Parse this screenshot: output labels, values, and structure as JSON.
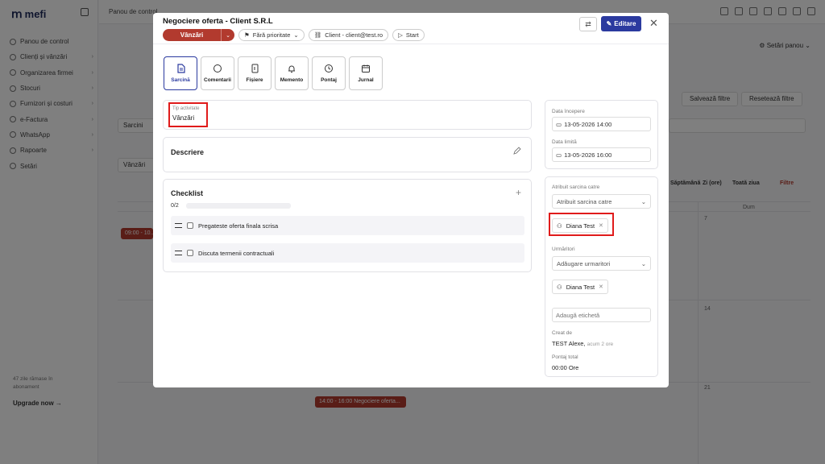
{
  "background": {
    "app_name": "mefi",
    "nav": [
      "Panou de control",
      "Clienți și vânzări",
      "Organizarea firmei",
      "Stocuri",
      "Furnizori și costuri",
      "e-Factura",
      "WhatsApp",
      "Rapoarte",
      "Setări"
    ],
    "trial_text": "47 zile rămase în abonament",
    "upgrade_label": "Upgrade now →",
    "breadcrumb": "Panou de control",
    "settings_label": "Setări panou",
    "save_filters": "Salvează filtre",
    "reset_filters": "Resetează filtre",
    "filter1_value": "Sarcini",
    "filter2_value": "Vânzări",
    "view_buttons": [
      "Săptămână",
      "Zi (ore)",
      "Toată ziua",
      "Filtre"
    ],
    "weekday": "Dum",
    "day_numbers": [
      "7",
      "14",
      "21"
    ],
    "event_left": "09:00 - 10...",
    "event_center": "14:00 - 16:00 Negociere oferta..."
  },
  "modal": {
    "title": "Negociere oferta - Client S.R.L",
    "status_label": "Vânzări",
    "priority_label": "Fără prioritate",
    "client_label": "Client - client@test.ro",
    "start_label": "Start",
    "edit_label": "Editare",
    "tabs": [
      {
        "label": "Sarcină",
        "icon": "document-icon"
      },
      {
        "label": "Comentarii",
        "icon": "comment-icon"
      },
      {
        "label": "Fișiere",
        "icon": "file-icon"
      },
      {
        "label": "Memento",
        "icon": "bell-icon"
      },
      {
        "label": "Pontaj",
        "icon": "clock-icon"
      },
      {
        "label": "Jurnal",
        "icon": "calendar-icon"
      }
    ],
    "activity_type_label": "Tip activitate",
    "activity_type_value": "Vânzări",
    "description_title": "Descriere",
    "checklist_title": "Checklist",
    "checklist_progress": "0/2",
    "checklist_progress_fraction": 0,
    "checklist_items": [
      "Pregateste oferta finala scrisa",
      "Discuta termenii contractuali"
    ],
    "start_date_label": "Data începere",
    "start_date_value": "13-05-2026 14:00",
    "deadline_label": "Data limită",
    "deadline_value": "13-05-2026 16:00",
    "assign_label": "Atribuit sarcina catre",
    "assign_placeholder": "Atribuit sarcina catre",
    "assignee": "Diana Test",
    "followers_label": "Urmăritori",
    "followers_placeholder": "Adăugare urmaritori",
    "follower": "Diana Test",
    "tag_placeholder": "Adaugă etichetă",
    "created_by_label": "Creat de",
    "created_by_value": "TEST Alexe,",
    "created_by_when": "acum 2 ore",
    "total_time_label": "Pontaj total",
    "total_time_value": "00:00 Ore"
  },
  "colors": {
    "accent": "#2b3a9f",
    "status_red": "#b23a2e",
    "highlight": "#e01b1b"
  }
}
